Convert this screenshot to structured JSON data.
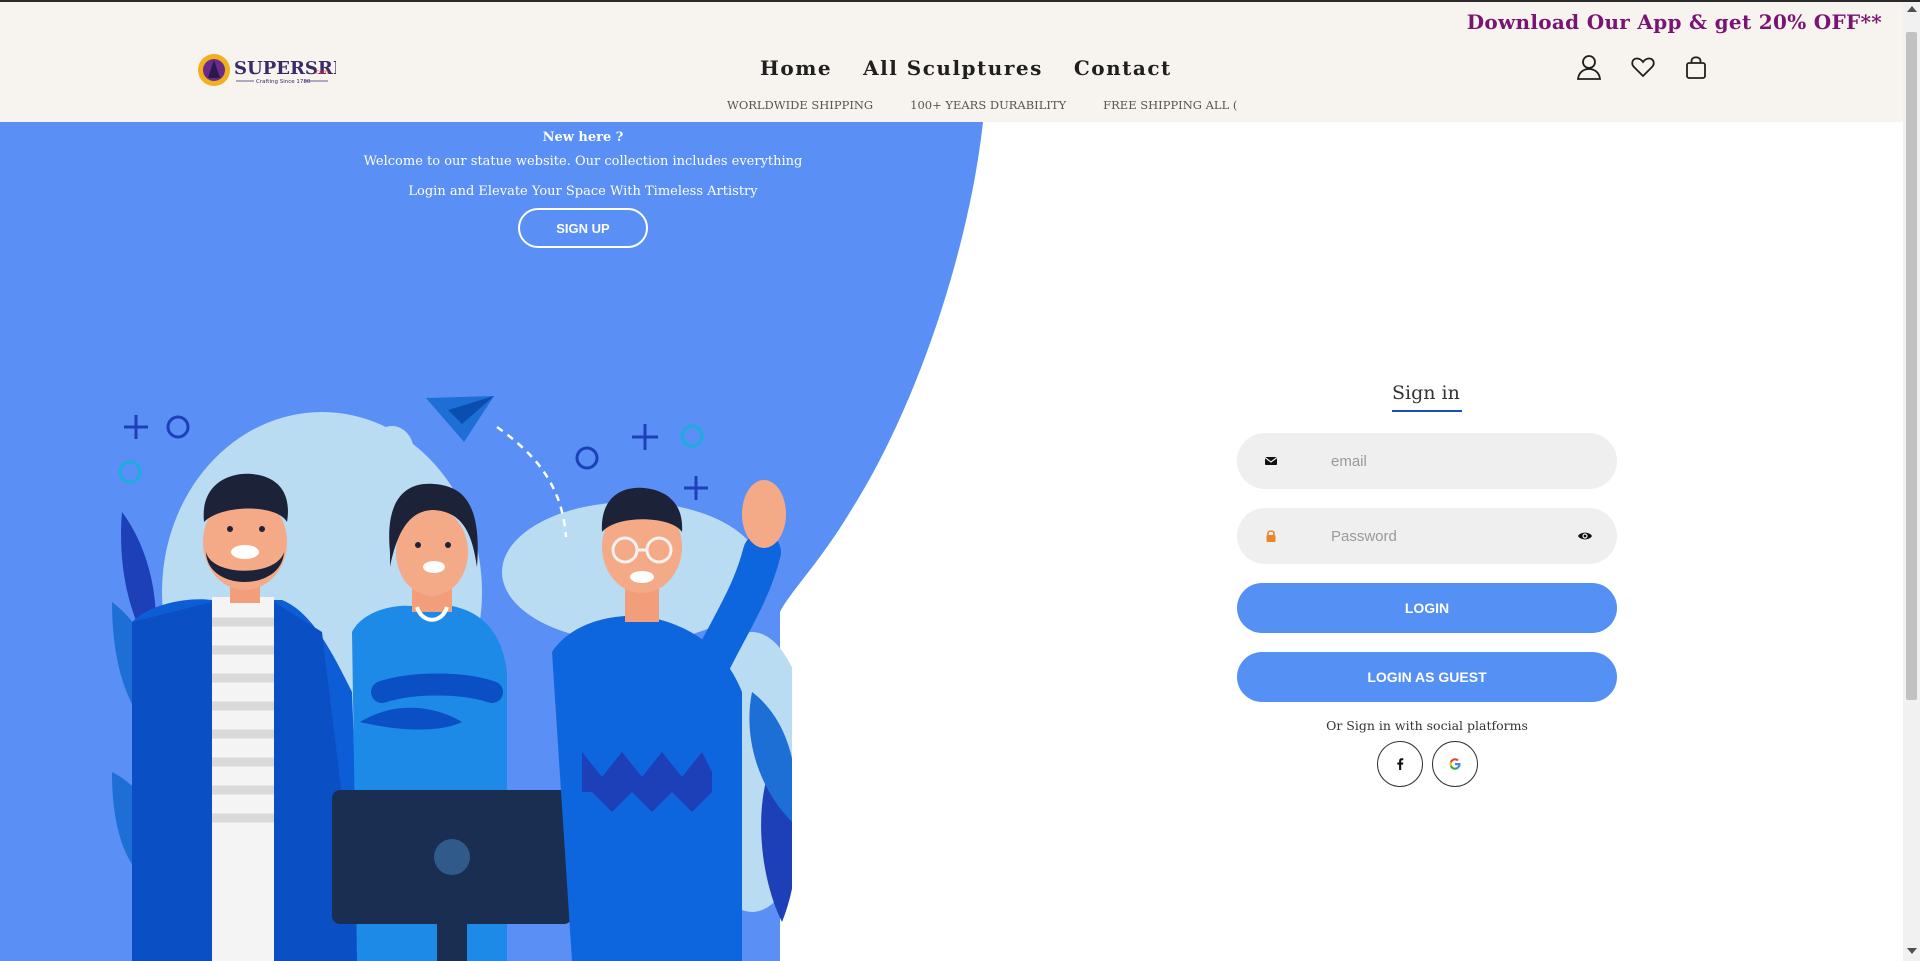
{
  "header": {
    "promo": "Download Our App & get 20% OFF**",
    "logo_text": "SUPERSRI",
    "logo_subtext": "Crafting Since 1780",
    "nav": [
      {
        "label": "Home"
      },
      {
        "label": "All Sculptures"
      },
      {
        "label": "Contact"
      }
    ],
    "icons": [
      "user-icon",
      "heart-icon",
      "bag-icon"
    ],
    "ticker": [
      "WORLDWIDE SHIPPING",
      "100+ YEARS DURABILITY",
      "FREE SHIPPING ALL ("
    ]
  },
  "left_panel": {
    "new_here": "New here ?",
    "welcome": "Welcome to our statue website. Our collection includes everything",
    "elevate": "Login and Elevate Your Space With Timeless Artistry",
    "signup_label": "SIGN UP",
    "illustration": "team-illustration"
  },
  "signin": {
    "title": "Sign in",
    "email_placeholder": "email",
    "email_value": "",
    "password_placeholder": "Password",
    "password_value": "",
    "login_label": "LOGIN",
    "guest_label": "LOGIN AS GUEST",
    "social_text": "Or Sign in with social platforms",
    "social": [
      "facebook-icon",
      "google-icon"
    ]
  },
  "colors": {
    "accent_blue": "#5590f4",
    "panel_blue": "#5a8ff5",
    "promo_purple": "#7a1474",
    "header_bg": "#f7f3ee",
    "lock_orange": "#e8872a"
  }
}
